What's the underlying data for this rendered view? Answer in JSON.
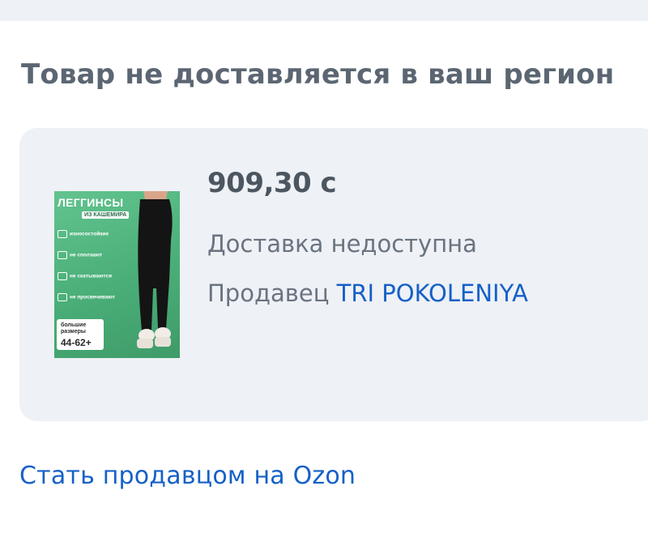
{
  "section_title": "Товар не доставляется в ваш регион",
  "product": {
    "image": {
      "title": "ЛЕГГИНСЫ",
      "subtitle": "ИЗ КАШЕМИРА",
      "features": [
        "износостойкие",
        "не сползают",
        "не скатываются",
        "не просвечивают"
      ],
      "sizes_label": "большие размеры",
      "sizes_range": "44-62+"
    },
    "price": "909,30 с",
    "delivery_status": "Доставка недоступна",
    "seller_label": "Продавец",
    "seller_name": "TRI POKOLENIYA"
  },
  "become_seller_link": "Стать продавцом на Ozon",
  "colors": {
    "link": "#1560c8",
    "card_bg": "#eef1f5",
    "heading": "#5c6673",
    "thumb_green": "#4aae78"
  }
}
